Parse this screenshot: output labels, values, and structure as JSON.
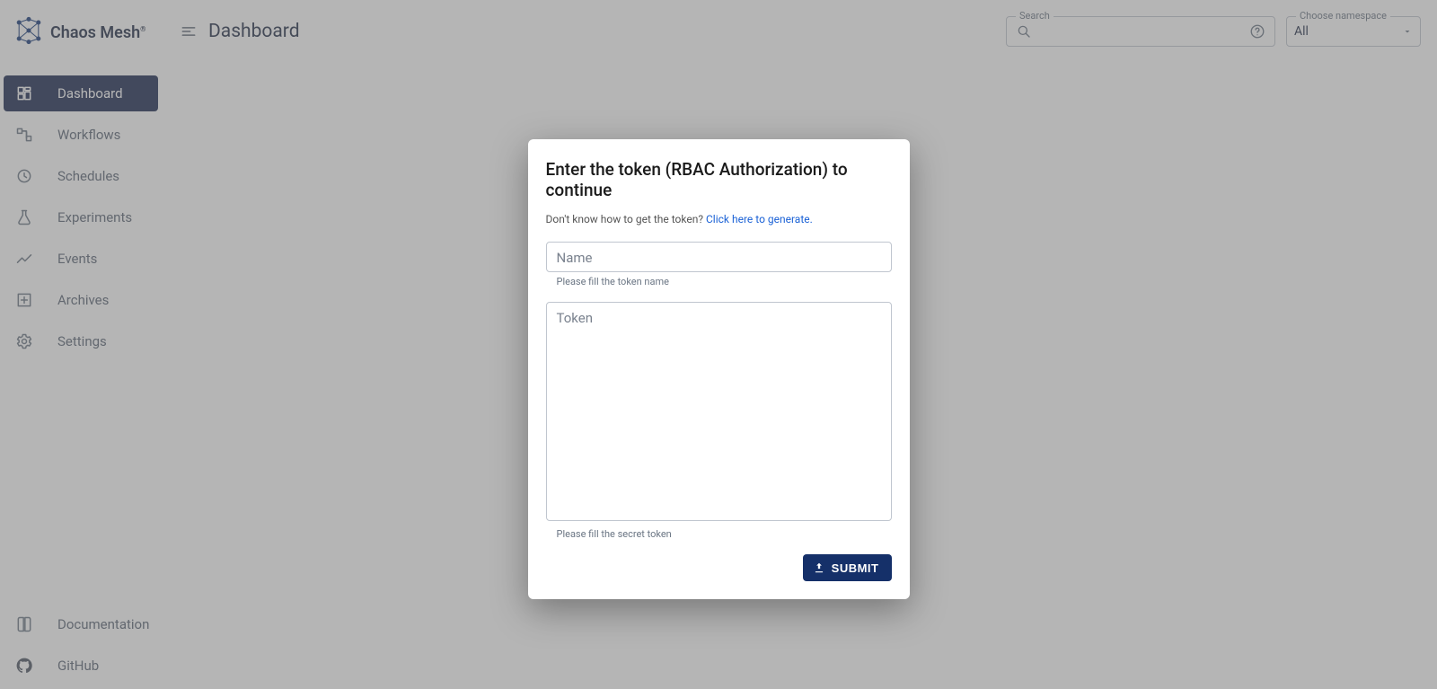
{
  "brand": {
    "name": "Chaos Mesh",
    "trademark": "®"
  },
  "page_title": "Dashboard",
  "search": {
    "label": "Search"
  },
  "namespace": {
    "label": "Choose namespace",
    "value": "All"
  },
  "sidebar": {
    "top": [
      {
        "label": "Dashboard",
        "icon": "dashboard-icon",
        "active": true
      },
      {
        "label": "Workflows",
        "icon": "workflow-icon",
        "active": false
      },
      {
        "label": "Schedules",
        "icon": "clock-icon",
        "active": false
      },
      {
        "label": "Experiments",
        "icon": "flask-icon",
        "active": false
      },
      {
        "label": "Events",
        "icon": "timeline-icon",
        "active": false
      },
      {
        "label": "Archives",
        "icon": "archive-icon",
        "active": false
      },
      {
        "label": "Settings",
        "icon": "gear-icon",
        "active": false
      }
    ],
    "bottom": [
      {
        "label": "Documentation",
        "icon": "book-icon"
      },
      {
        "label": "GitHub",
        "icon": "github-icon"
      }
    ]
  },
  "dialog": {
    "title": "Enter the token (RBAC Authorization) to continue",
    "hint_prefix": "Don't know how to get the token? ",
    "hint_link": "Click here to generate.",
    "name_placeholder": "Name",
    "name_helper": "Please fill the token name",
    "token_placeholder": "Token",
    "token_helper": "Please fill the secret token",
    "submit_label": "SUBMIT"
  }
}
